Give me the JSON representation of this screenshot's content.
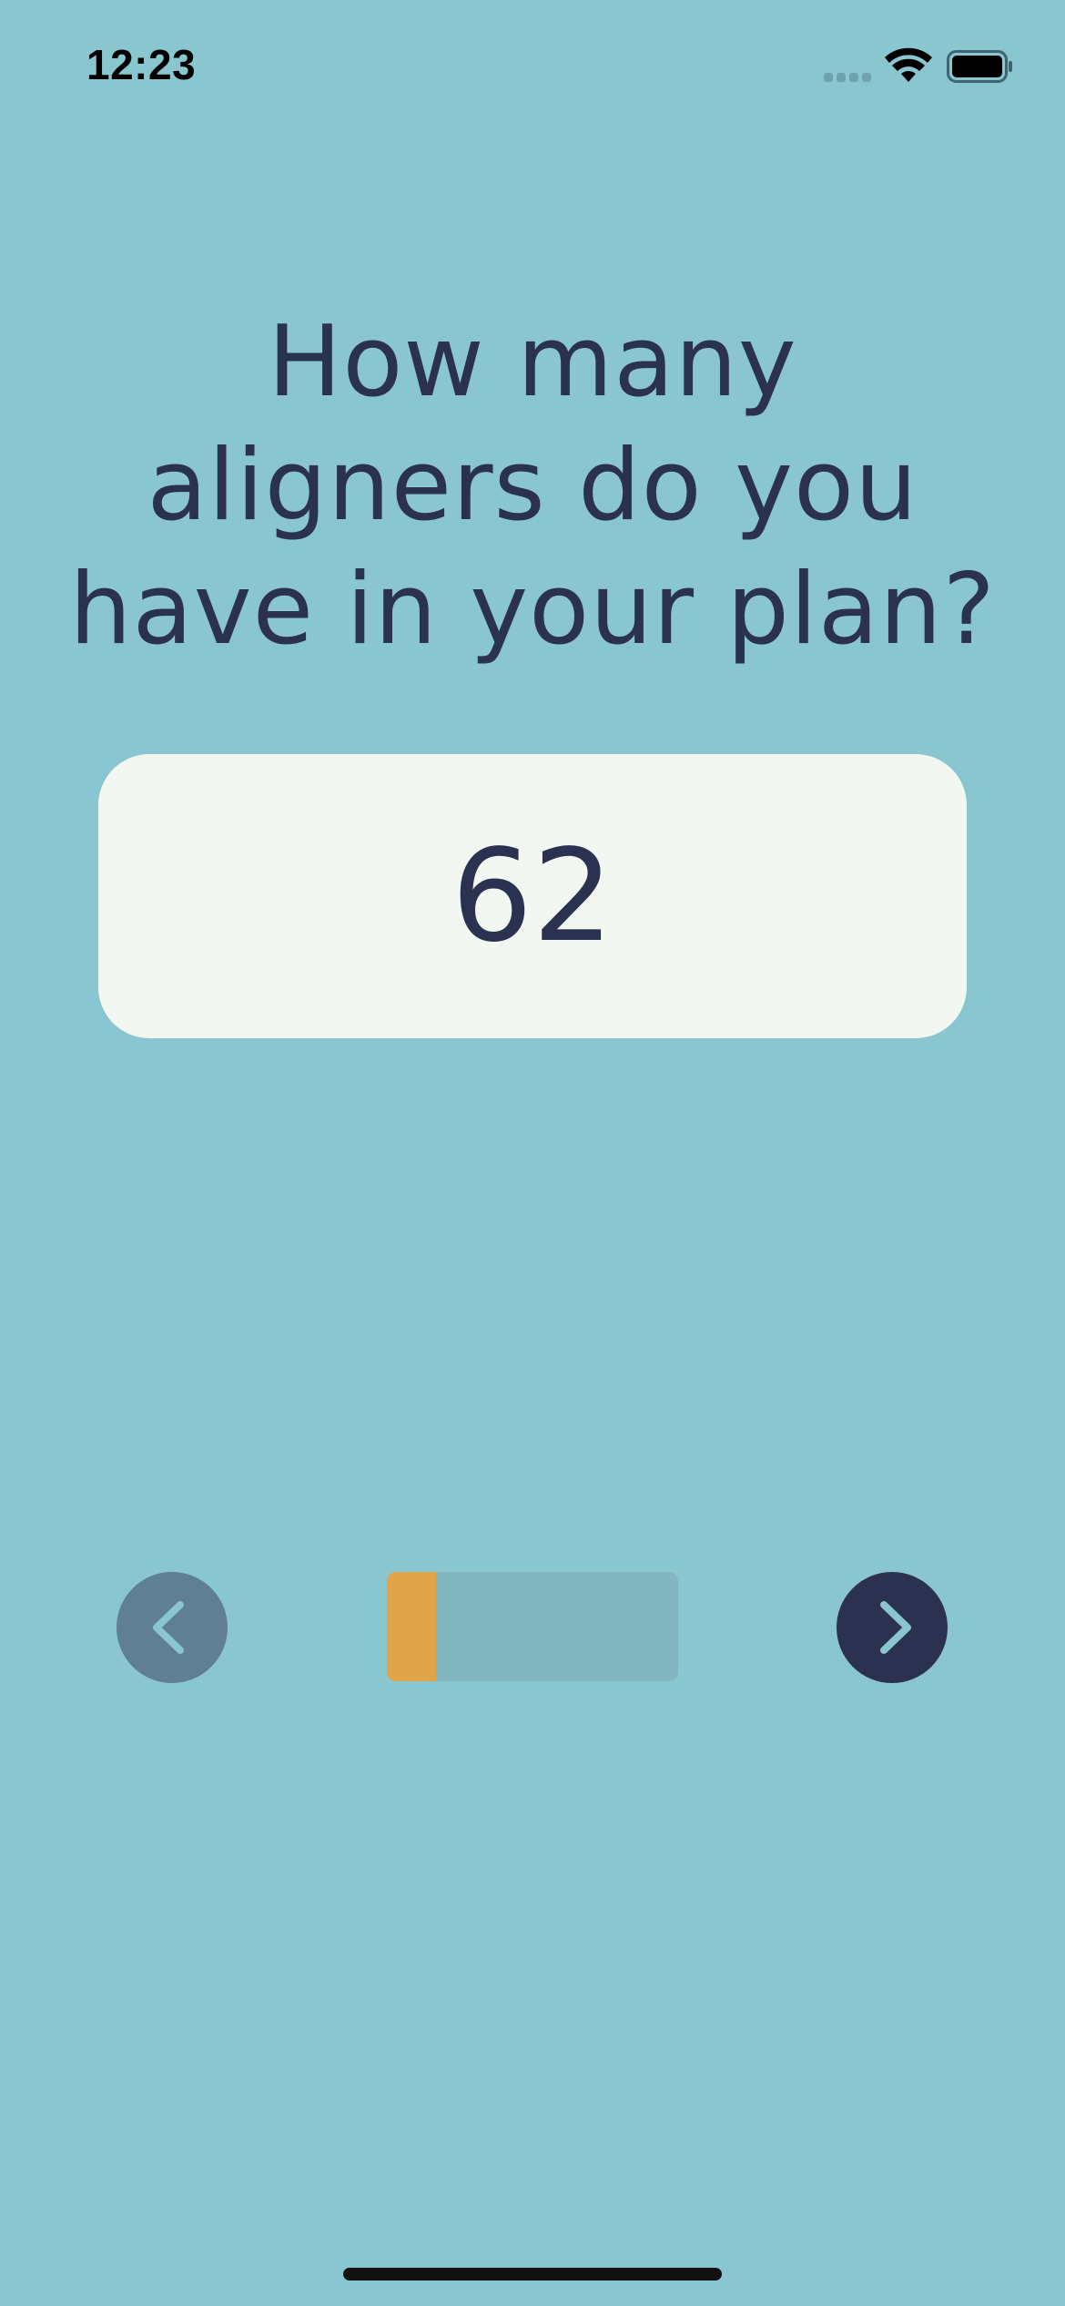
{
  "status_bar": {
    "time": "12:23",
    "icons": [
      "cellular-signal-icon",
      "wifi-icon",
      "battery-icon"
    ]
  },
  "question": {
    "line1": "How many",
    "line2": "aligners do you",
    "line3": "have in your plan?"
  },
  "answer": {
    "value": "62"
  },
  "navigation": {
    "prev_icon": "chevron-left-icon",
    "next_icon": "chevron-right-icon",
    "progress_fraction": 0.17
  },
  "colors": {
    "background": "#8ac6d0",
    "text": "#2b3150",
    "card": "#f2f7f2",
    "accent": "#e2a44b",
    "prev_button": "#5e7f94",
    "next_button": "#2b3150",
    "progress_track": "#82b7bf"
  }
}
